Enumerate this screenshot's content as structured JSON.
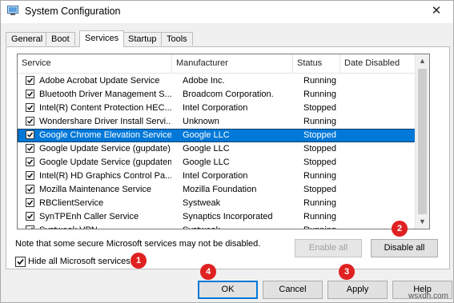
{
  "window": {
    "title": "System Configuration",
    "close_glyph": "✕"
  },
  "tabs": [
    "General",
    "Boot",
    "Services",
    "Startup",
    "Tools"
  ],
  "columns": [
    "Service",
    "Manufacturer",
    "Status",
    "Date Disabled"
  ],
  "services": [
    {
      "service": "Adobe Acrobat Update Service",
      "manufacturer": "Adobe Inc.",
      "status": "Running",
      "checked": true
    },
    {
      "service": "Bluetooth Driver Management S...",
      "manufacturer": "Broadcom Corporation.",
      "status": "Running",
      "checked": true
    },
    {
      "service": "Intel(R) Content Protection HEC...",
      "manufacturer": "Intel Corporation",
      "status": "Stopped",
      "checked": true
    },
    {
      "service": "Wondershare Driver Install Servi...",
      "manufacturer": "Unknown",
      "status": "Running",
      "checked": true
    },
    {
      "service": "Google Chrome Elevation Service",
      "manufacturer": "Google LLC",
      "status": "Stopped",
      "checked": true,
      "selected": true
    },
    {
      "service": "Google Update Service (gupdate)",
      "manufacturer": "Google LLC",
      "status": "Stopped",
      "checked": true
    },
    {
      "service": "Google Update Service (gupdatem)",
      "manufacturer": "Google LLC",
      "status": "Stopped",
      "checked": true
    },
    {
      "service": "Intel(R) HD Graphics Control Pa...",
      "manufacturer": "Intel Corporation",
      "status": "Running",
      "checked": true
    },
    {
      "service": "Mozilla Maintenance Service",
      "manufacturer": "Mozilla Foundation",
      "status": "Stopped",
      "checked": true
    },
    {
      "service": "RBClientService",
      "manufacturer": "Systweak",
      "status": "Running",
      "checked": true
    },
    {
      "service": "SynTPEnh Caller Service",
      "manufacturer": "Synaptics Incorporated",
      "status": "Running",
      "checked": true
    },
    {
      "service": "Systweak VPN",
      "manufacturer": "Systweak",
      "status": "Running",
      "checked": true
    }
  ],
  "note": "Note that some secure Microsoft services may not be disabled.",
  "buttons": {
    "enable_all": "Enable all",
    "disable_all": "Disable all",
    "ok": "OK",
    "cancel": "Cancel",
    "apply": "Apply",
    "help": "Help"
  },
  "hide_ms_services": {
    "label": "Hide all Microsoft services",
    "checked": true
  },
  "markers": [
    "1",
    "2",
    "3",
    "4"
  ],
  "watermark": "wsxdn.com",
  "colors": {
    "selection": "#0078d7",
    "marker": "#e02121"
  }
}
